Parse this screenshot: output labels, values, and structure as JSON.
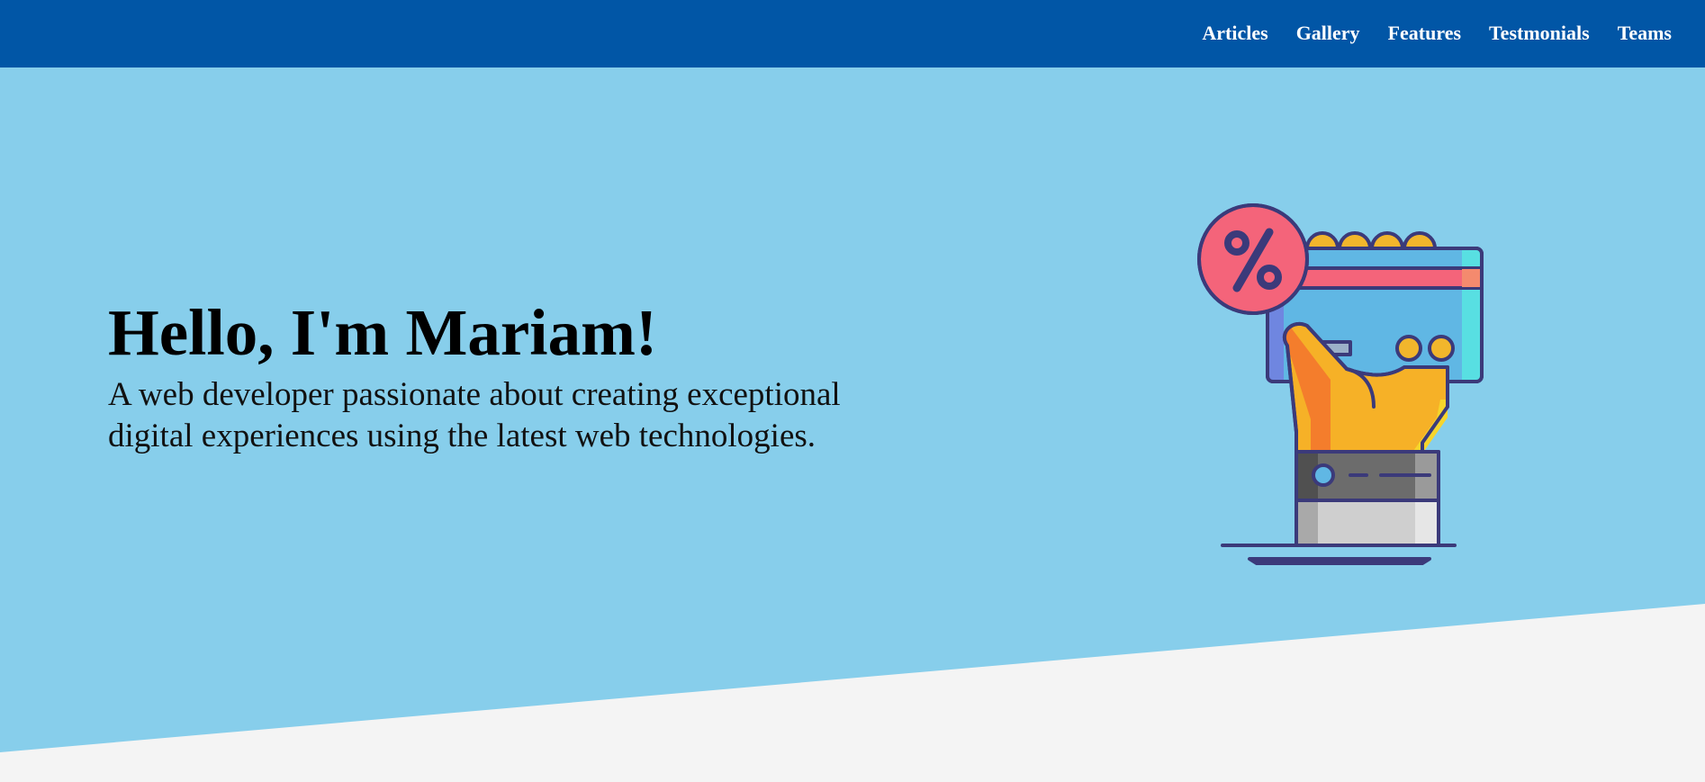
{
  "nav": {
    "links": [
      {
        "label": "Articles"
      },
      {
        "label": "Gallery"
      },
      {
        "label": "Features"
      },
      {
        "label": "Testmonials"
      },
      {
        "label": "Teams"
      }
    ]
  },
  "hero": {
    "title": "Hello, I'm Mariam!",
    "subtitle": "A web developer passionate about creating exceptional digital experiences using the latest web technologies.",
    "illustration_icon": "hand-holding-card-with-percent-badge-icon"
  },
  "colors": {
    "navbar": "#0156a6",
    "hero_background": "#87ceeb",
    "page_background": "#f4f4f4",
    "nav_text": "#ffffff"
  }
}
